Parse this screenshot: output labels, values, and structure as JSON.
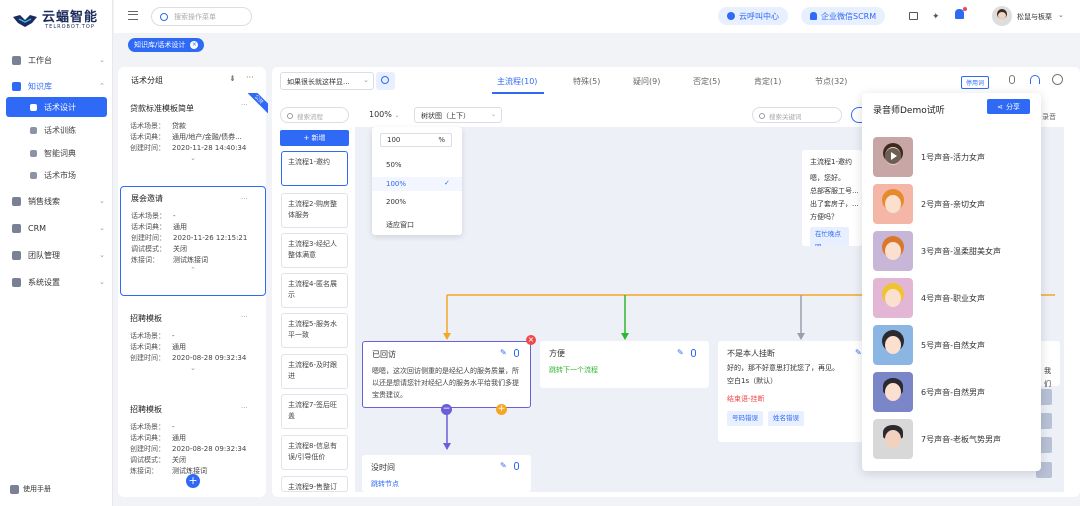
{
  "brand": {
    "name": "云蝠智能",
    "sub": "TELROBOT.TOP"
  },
  "nav": {
    "workbench": "工作台",
    "library": "知识库",
    "script_design": "话术设计",
    "script_training": "话术训练",
    "smart_dict": "智能词典",
    "script_market": "话术市场",
    "sales_leads": "销售线索",
    "crm": "CRM",
    "team": "团队管理",
    "settings": "系统设置",
    "manual": "使用手册"
  },
  "topbar": {
    "search_placeholder": "搜索操作菜单",
    "call_center": "云呼叫中心",
    "wecom": "企业微信SCRM",
    "user": "松鼠与板栗"
  },
  "breadcrumb": "知识库/话术设计",
  "groups": {
    "title": "话术分组",
    "cards": [
      {
        "title": "贷款标准模板简单",
        "badge": "公共",
        "scene_label": "话术场景：",
        "scene": "贷款",
        "dict_label": "话术词典：",
        "dict": "通用/地产/金融/债券...",
        "time_label": "创建时间：",
        "time": "2020-11-28 14:40:34"
      },
      {
        "title": "展会邀请",
        "scene_label": "话术场景：",
        "scene": "-",
        "dict_label": "话术词典：",
        "dict": "通用",
        "time_label": "创建时间：",
        "time": "2020-11-26 12:15:21",
        "mode_label": "调试模式：",
        "mode": "关闭",
        "line_label": "炼接词：",
        "line": "测试炼接词"
      },
      {
        "title": "招聘模板",
        "scene_label": "话术场景：",
        "scene": "-",
        "dict_label": "话术词典：",
        "dict": "通用",
        "time_label": "创建时间：",
        "time": "2020-08-28 09:32:34"
      },
      {
        "title": "招聘模板",
        "scene_label": "话术场景：",
        "scene": "-",
        "dict_label": "话术词典：",
        "dict": "通用",
        "time_label": "创建时间：",
        "time": "2020-08-28 09:32:34",
        "mode_label": "调试模式：",
        "mode": "关闭",
        "line_label": "炼接词：",
        "line": "测试炼接词"
      }
    ]
  },
  "editor": {
    "select": "如果很长就这样显...",
    "tabs": [
      "主流程(10)",
      "特殊(5)",
      "疑问(9)",
      "否定(5)",
      "肯定(1)",
      "节点(32)"
    ],
    "common_words": "停用词",
    "flow_search": "搜索流程",
    "add": "+ 新增",
    "flows": [
      "主流程1-邀约",
      "主流程2-购房整体服务",
      "主流程3-经纪人整体满意",
      "主流程4-匿名展示",
      "主流程5-服务水平一致",
      "主流程6-及时跟进",
      "主流程7-签后旺盖",
      "主流程8-信息有误/引导低价",
      "主流程9-售整订"
    ],
    "zoom": "100%",
    "layout": "树状图（上下）",
    "keyword_search": "搜索关键词",
    "zoom_input": "100",
    "zoom_unit": "%",
    "zoom_options": [
      "50%",
      "100%",
      "200%",
      "适应窗口"
    ],
    "top_node": {
      "title": "主流程1-邀约",
      "l1": "嗯，您好。",
      "l2": "总部客服工号...",
      "l3": "出了套房子，...",
      "l4": "方便吗？",
      "tag": "在忙晚点回..."
    },
    "node_busy": {
      "title": "已回访",
      "text": "嗯嗯，这次回访侧重的是经纪人的服务质量，所以还是想请您针对经纪人的服务水平给我们多提宝贵建议。"
    },
    "node_convenient": {
      "title": "方便",
      "text": "跳转下一个流程"
    },
    "node_not_self": {
      "title": "不是本人挂断",
      "text": "好的，那不好意思打扰您了，再见。",
      "blank": "空白1s（默认）",
      "end": "结束语-挂断",
      "tag1": "号码错误",
      "tag2": "姓名错误"
    },
    "node_no_time": {
      "title": "没时间",
      "text": "跳转节点"
    },
    "partial_right": "我们",
    "partial_top": "录音"
  },
  "voices": {
    "title": "录音师Demo试听",
    "share": "分享",
    "items": [
      {
        "label": "1号声音-活力女声",
        "bg": "#c9a6a6"
      },
      {
        "label": "2号声音-亲切女声",
        "bg": "#f4b6a6"
      },
      {
        "label": "3号声音-温柔甜美女声",
        "bg": "#c7b6d8"
      },
      {
        "label": "4号声音-职业女声",
        "bg": "#e3b6d6"
      },
      {
        "label": "5号声音-自然女声",
        "bg": "#8bb6e3"
      },
      {
        "label": "6号声音-自然男声",
        "bg": "#7a86c7"
      },
      {
        "label": "7号声音-老板气势男声",
        "bg": "#d8d8d8"
      }
    ]
  },
  "colors": {
    "accent": "#2f6af6",
    "orange": "#f5a623",
    "green": "#2eb82e",
    "red": "#f0484a",
    "purple": "#6a5fd8"
  }
}
